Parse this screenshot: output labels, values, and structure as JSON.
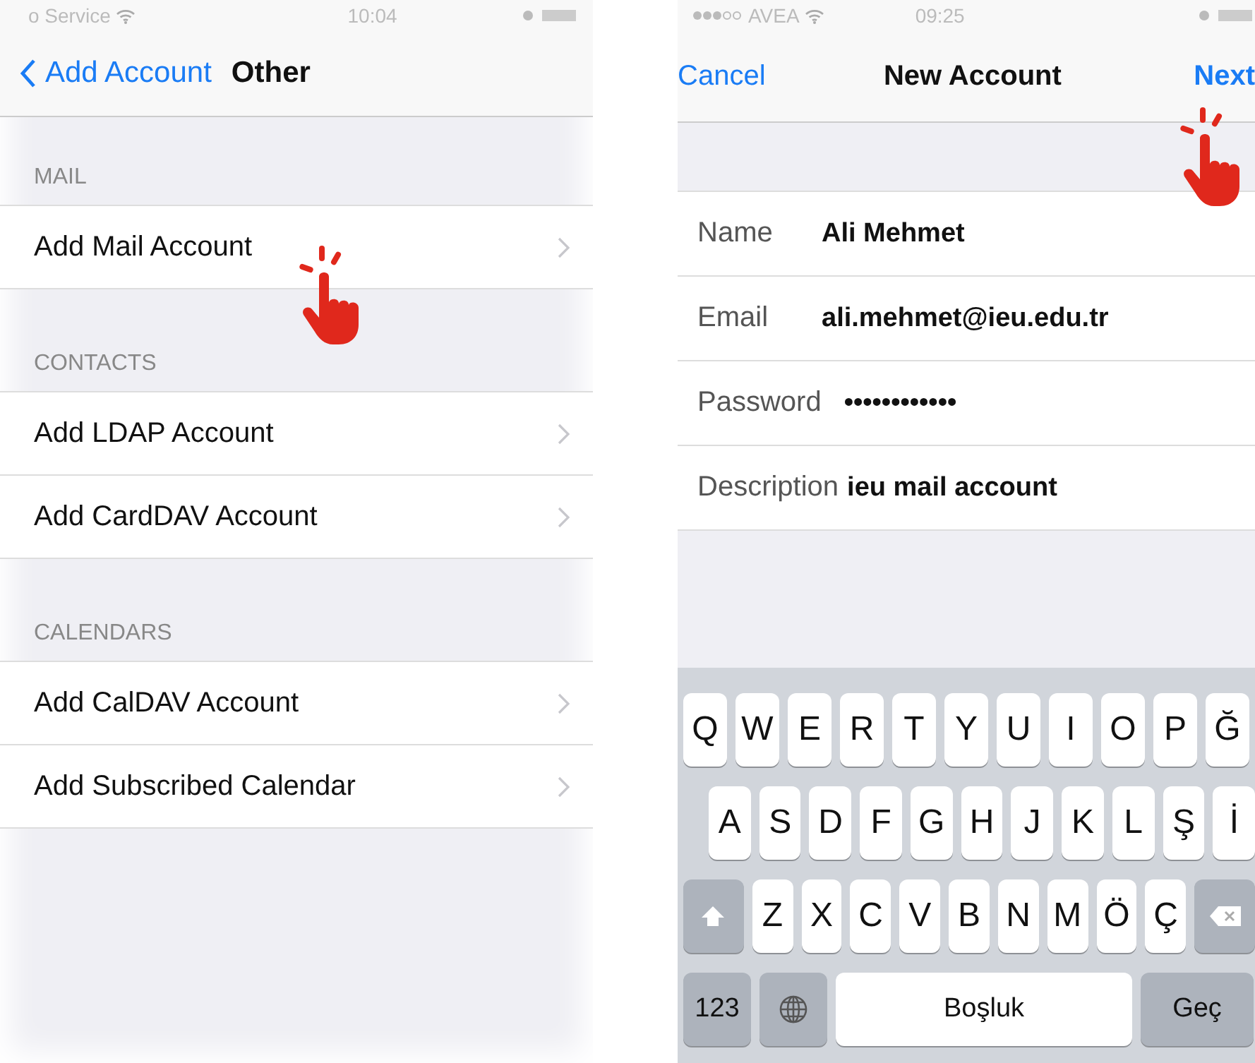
{
  "left_screen": {
    "status_bar": {
      "carrier": "o Service",
      "time": "10:04"
    },
    "nav_bar": {
      "back": "Add Account",
      "title": "Other"
    },
    "sections": [
      {
        "header": "MAIL",
        "items": [
          "Add Mail Account"
        ]
      },
      {
        "header": "CONTACTS",
        "items": [
          "Add LDAP Account",
          "Add CardDAV Account"
        ]
      },
      {
        "header": "CALENDARS",
        "items": [
          "Add CalDAV Account",
          "Add Subscribed Calendar"
        ]
      }
    ]
  },
  "right_screen": {
    "status_bar": {
      "carrier": "AVEA",
      "time": "09:25"
    },
    "nav_bar": {
      "cancel": "Cancel",
      "title": "New Account",
      "next": "Next"
    },
    "fields": [
      {
        "label": "Name",
        "value": "Ali Mehmet"
      },
      {
        "label": "Email",
        "value": "ali.mehmet@ieu.edu.tr"
      },
      {
        "label": "Password",
        "value": "••••••••••••"
      },
      {
        "label": "Description",
        "value": "ieu mail account"
      }
    ],
    "keyboard": [
      [
        {
          "kind": "letter",
          "label": "Q"
        },
        {
          "kind": "letter",
          "label": "W"
        },
        {
          "kind": "letter",
          "label": "E"
        },
        {
          "kind": "letter",
          "label": "R"
        },
        {
          "kind": "letter",
          "label": "T"
        },
        {
          "kind": "letter",
          "label": "Y"
        },
        {
          "kind": "letter",
          "label": "U"
        },
        {
          "kind": "letter",
          "label": "I"
        },
        {
          "kind": "letter",
          "label": "O"
        },
        {
          "kind": "letter",
          "label": "P"
        },
        {
          "kind": "letter",
          "label": "Ğ"
        }
      ],
      [
        {
          "kind": "letter",
          "label": "A"
        },
        {
          "kind": "letter",
          "label": "S"
        },
        {
          "kind": "letter",
          "label": "D"
        },
        {
          "kind": "letter",
          "label": "F"
        },
        {
          "kind": "letter",
          "label": "G"
        },
        {
          "kind": "letter",
          "label": "H"
        },
        {
          "kind": "letter",
          "label": "J"
        },
        {
          "kind": "letter",
          "label": "K"
        },
        {
          "kind": "letter",
          "label": "L"
        },
        {
          "kind": "letter",
          "label": "Ş"
        },
        {
          "kind": "letter",
          "label": "İ"
        }
      ],
      [
        {
          "kind": "shift"
        },
        {
          "kind": "letter",
          "label": "Z"
        },
        {
          "kind": "letter",
          "label": "X"
        },
        {
          "kind": "letter",
          "label": "C"
        },
        {
          "kind": "letter",
          "label": "V"
        },
        {
          "kind": "letter",
          "label": "B"
        },
        {
          "kind": "letter",
          "label": "N"
        },
        {
          "kind": "letter",
          "label": "M"
        },
        {
          "kind": "letter",
          "label": "Ö"
        },
        {
          "kind": "letter",
          "label": "Ç"
        },
        {
          "kind": "delete"
        }
      ],
      [
        {
          "kind": "mode",
          "label": "123"
        },
        {
          "kind": "globe"
        },
        {
          "kind": "space",
          "label": "Boşluk"
        },
        {
          "kind": "return",
          "label": "Geç"
        }
      ]
    ]
  }
}
